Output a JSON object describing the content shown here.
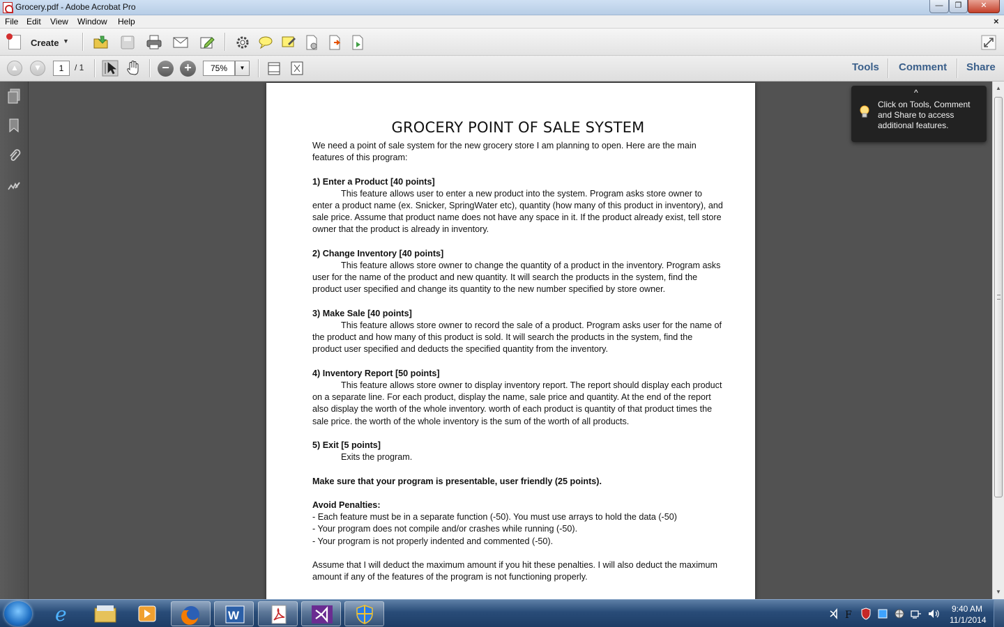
{
  "window": {
    "title": "Grocery.pdf - Adobe Acrobat Pro",
    "min_glyph": "—",
    "max_glyph": "❐",
    "close_glyph": "✕"
  },
  "menu": {
    "items": [
      "File",
      "Edit",
      "View",
      "Window",
      "Help"
    ],
    "doc_close": "×"
  },
  "toolbar": {
    "create_label": "Create",
    "create_caret": "▼",
    "page_current": "1",
    "page_total": "/ 1",
    "zoom_value": "75%",
    "zoom_caret": "▼",
    "zoom_out_glyph": "−",
    "zoom_in_glyph": "+",
    "prev_glyph": "▲",
    "next_glyph": "▼"
  },
  "panes": {
    "tools": "Tools",
    "comment": "Comment",
    "share": "Share"
  },
  "tooltip": {
    "caret": "^",
    "text": "Click on Tools, Comment and Share to access additional features."
  },
  "document": {
    "title": "GROCERY POINT OF SALE SYSTEM",
    "intro": "We need a point of sale system for the new grocery store I am planning to open. Here are the main features of this program:",
    "s1_heading": "1) Enter a Product [40 points]",
    "s1_body": "This feature allows user to enter a new product into the system. Program asks store owner to enter a product name (ex. Snicker, SpringWater etc), quantity (how many of this product in inventory), and sale price. Assume that product name does not have any space in it. If the product already exist, tell store owner that the product is already in inventory.",
    "s2_heading": "2) Change Inventory [40 points]",
    "s2_body": "This feature allows store owner to change the quantity of a product in the inventory. Program asks user for the name of the product and new quantity. It will search the products in the system, find the product user specified and change its quantity to the new number specified by store owner.",
    "s3_heading": "3) Make Sale [40 points]",
    "s3_body": "This feature allows store owner to record the sale of a product. Program asks user for the name of the product and how many of this product is sold. It will search the products in the system, find the product user specified and deducts the specified quantity from the inventory.",
    "s4_heading": "4) Inventory Report [50 points]",
    "s4_body": "This feature allows store owner to display inventory report. The report should display each product on a separate line. For each product, display the name, sale price and quantity. At the end of the report also display the worth of the whole inventory.  worth of each product is quantity of that product times the sale price. the worth of the whole inventory is the sum of the worth of all products.",
    "s5_heading": "5) Exit [5 points]",
    "s5_body": "Exits the program.",
    "presentable": "Make sure that your program is presentable, user friendly (25 points).",
    "penalties_heading": "Avoid Penalties:",
    "penalty_1": "- Each feature must be in a separate function (-50). You must use arrays to hold the data (-50)",
    "penalty_2": "- Your program does not compile and/or crashes while running (-50).",
    "penalty_3": "- Your program is not properly indented and commented (-50).",
    "closing": "Assume that I will deduct the maximum amount if you hit these penalties. I will also deduct the maximum amount if any of the features of the program is not functioning properly."
  },
  "scrollbar": {
    "up_glyph": "▲",
    "down_glyph": "▼"
  },
  "taskbar": {
    "time": "9:40 AM",
    "date": "11/1/2014"
  },
  "icons": {
    "nav_pane": [
      "pages-icon",
      "bookmarks-icon",
      "attachments-icon",
      "signatures-icon"
    ],
    "toolbar": [
      "open-folder-icon",
      "save-icon",
      "print-icon",
      "email-icon",
      "edit-pen-icon",
      "gear-icon",
      "comment-bubble-icon",
      "sticky-note-icon",
      "forms-icon",
      "export-icon",
      "sign-icon",
      "expand-icon"
    ],
    "taskbar": [
      "start-orb-icon",
      "internet-explorer-icon",
      "file-explorer-icon",
      "media-player-icon",
      "firefox-icon",
      "word-icon",
      "acrobat-icon",
      "visual-studio-icon",
      "security-shield-icon"
    ]
  },
  "colors": {
    "pane_link": "#3a5f8a",
    "doc_background": "#525252",
    "taskbar": "#294c78"
  }
}
